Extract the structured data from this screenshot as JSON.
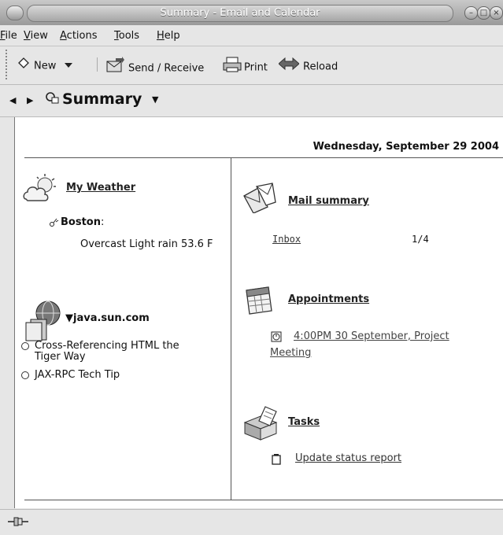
{
  "window": {
    "title": "Summary - Email and Calendar"
  },
  "menubar": {
    "items": [
      {
        "first": "F",
        "rest": "ile"
      },
      {
        "first": "V",
        "rest": "iew"
      },
      {
        "first": "A",
        "rest": "ctions"
      },
      {
        "first": "T",
        "rest": "ools"
      },
      {
        "first": "H",
        "rest": "elp"
      }
    ]
  },
  "toolbar": {
    "new_label": "New",
    "send_receive_label": "Send / Receive",
    "print_label": "Print",
    "reload_label": "Reload"
  },
  "location": {
    "title": "Summary"
  },
  "summary": {
    "date": "Wednesday, September 29 2004",
    "weather": {
      "heading": "My Weather",
      "city": "Boston",
      "city_suffix": ":",
      "conditions": "Overcast Light rain 53.6 F"
    },
    "news": {
      "heading": "java.sun.com",
      "items": [
        {
          "line1": "Cross-Referencing HTML the",
          "line2": "Tiger Way"
        },
        {
          "line1": "JAX-RPC Tech Tip",
          "line2": ""
        }
      ]
    },
    "mail": {
      "heading": "Mail summary",
      "folder": "Inbox",
      "count": "1/4"
    },
    "appointments": {
      "heading": "Appointments",
      "item_line1": "4:00PM 30 September, Project",
      "item_line2": "Meeting"
    },
    "tasks": {
      "heading": "Tasks",
      "item": "Update status report"
    }
  },
  "icons": {
    "window_menu": "window-menu-icon",
    "new": "new-document-icon",
    "dropdown": "dropdown-arrow-icon",
    "send_receive": "send-receive-icon",
    "print": "printer-icon",
    "reload": "reload-icon",
    "back": "back-arrow-icon",
    "forward": "forward-arrow-icon",
    "summary": "summary-icon",
    "weather": "weather-cloud-icon",
    "news": "globe-news-icon",
    "mail": "mail-envelope-icon",
    "calendar": "calendar-icon",
    "tasks": "tasks-box-icon",
    "connection": "connection-plug-icon"
  }
}
